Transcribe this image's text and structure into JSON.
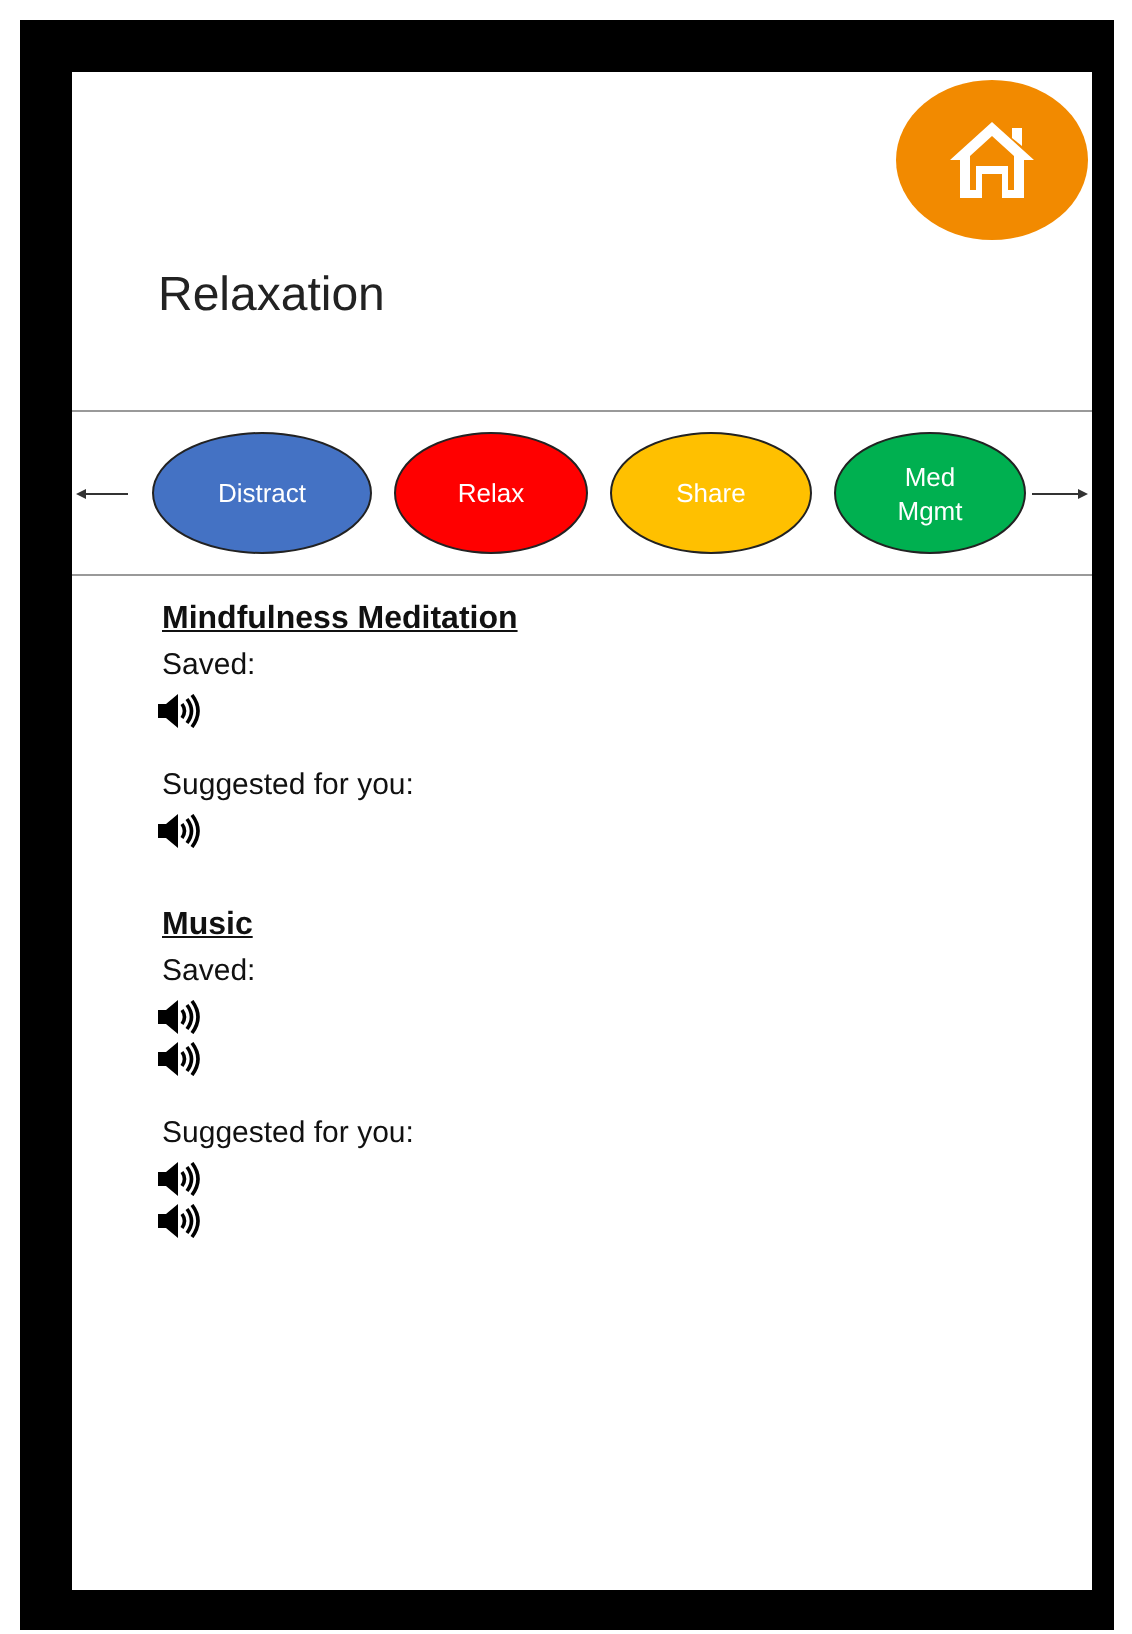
{
  "home_button": {
    "kind": "home"
  },
  "title": "Relaxation",
  "nav": {
    "categories": [
      {
        "label": "Distract",
        "color": "#4472c4"
      },
      {
        "label": "Relax",
        "color": "#ff0000"
      },
      {
        "label": "Share",
        "color": "#ffc000"
      },
      {
        "label": "Med Mgmt",
        "color": "#00b050"
      }
    ]
  },
  "sections": [
    {
      "heading": "Mindfulness Meditation",
      "groups": [
        {
          "label": "Saved:",
          "items": [
            {
              "kind": "audio"
            }
          ]
        },
        {
          "label": "Suggested for you:",
          "items": [
            {
              "kind": "audio"
            }
          ]
        }
      ]
    },
    {
      "heading": "Music",
      "groups": [
        {
          "label": "Saved:",
          "items": [
            {
              "kind": "audio"
            },
            {
              "kind": "audio"
            }
          ]
        },
        {
          "label": "Suggested for you:",
          "items": [
            {
              "kind": "audio"
            },
            {
              "kind": "audio"
            }
          ]
        }
      ]
    }
  ]
}
